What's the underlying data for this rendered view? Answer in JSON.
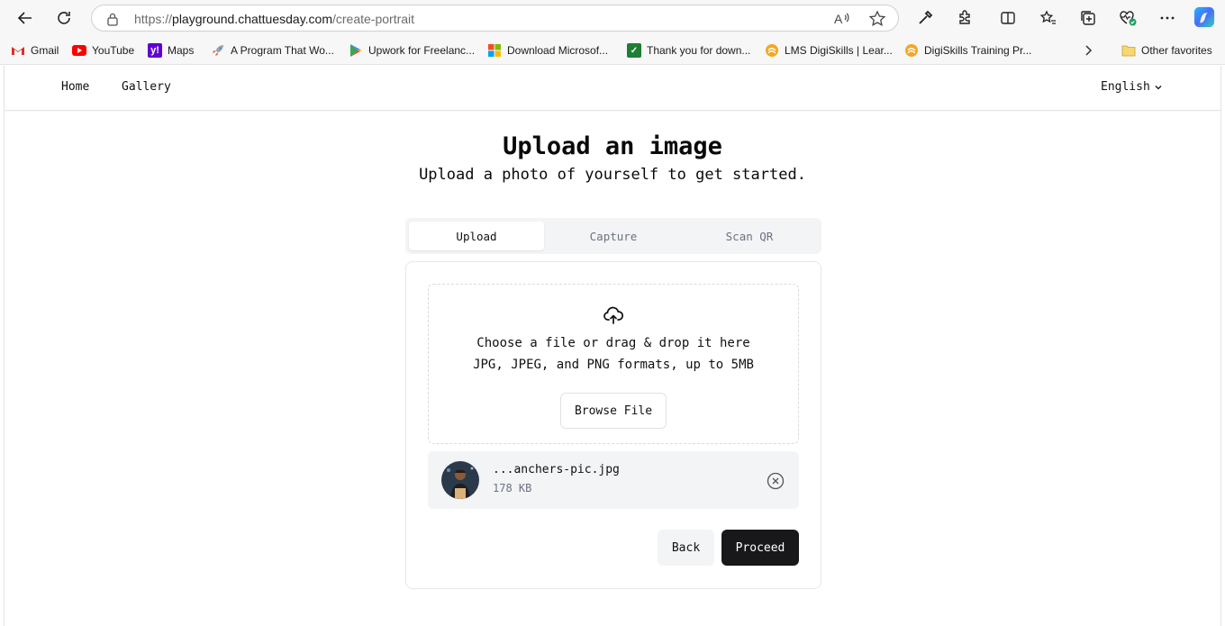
{
  "browser": {
    "url_prefix": "https://",
    "url_host": "playground.chattuesday.com",
    "url_path": "/create-portrait",
    "bookmarks": [
      {
        "label": "Gmail",
        "icon": "gmail-icon",
        "color": "#d93025"
      },
      {
        "label": "YouTube",
        "icon": "youtube-icon",
        "color": "#ff0000"
      },
      {
        "label": "Maps",
        "icon": "yahoo-icon",
        "color": "#6001d2"
      },
      {
        "label": "A Program That Wo...",
        "icon": "rocket-icon",
        "color": "#e8553e"
      },
      {
        "label": "Upwork for Freelanc...",
        "icon": "play-store-icon",
        "color": "#34a853"
      },
      {
        "label": "Download Microsof...",
        "icon": "microsoft-icon",
        "color": "#f25022"
      },
      {
        "label": "Thank you for down...",
        "icon": "spreadsheet-icon",
        "color": "#1e7e34"
      },
      {
        "label": "LMS DigiSkills | Lear...",
        "icon": "digiskills-icon",
        "color": "#f5a623"
      },
      {
        "label": "DigiSkills Training Pr...",
        "icon": "digiskills-icon",
        "color": "#f5a623"
      }
    ],
    "other_favorites": "Other favorites"
  },
  "nav": {
    "home": "Home",
    "gallery": "Gallery",
    "language": "English"
  },
  "header": {
    "title": "Upload an image",
    "subtitle": "Upload a photo of yourself to get started."
  },
  "tabs": [
    {
      "label": "Upload",
      "active": true
    },
    {
      "label": "Capture",
      "active": false
    },
    {
      "label": "Scan QR",
      "active": false
    }
  ],
  "dropzone": {
    "main_text": "Choose a file or drag & drop it here",
    "sub_text": "JPG, JPEG, and PNG formats, up to 5MB",
    "browse_label": "Browse File"
  },
  "file": {
    "name": "...anchers-pic.jpg",
    "size": "178 KB"
  },
  "actions": {
    "back": "Back",
    "proceed": "Proceed"
  },
  "colors": {
    "primary_button": "#18181b",
    "muted_bg": "#f3f4f6",
    "muted_text": "#6b7280"
  }
}
